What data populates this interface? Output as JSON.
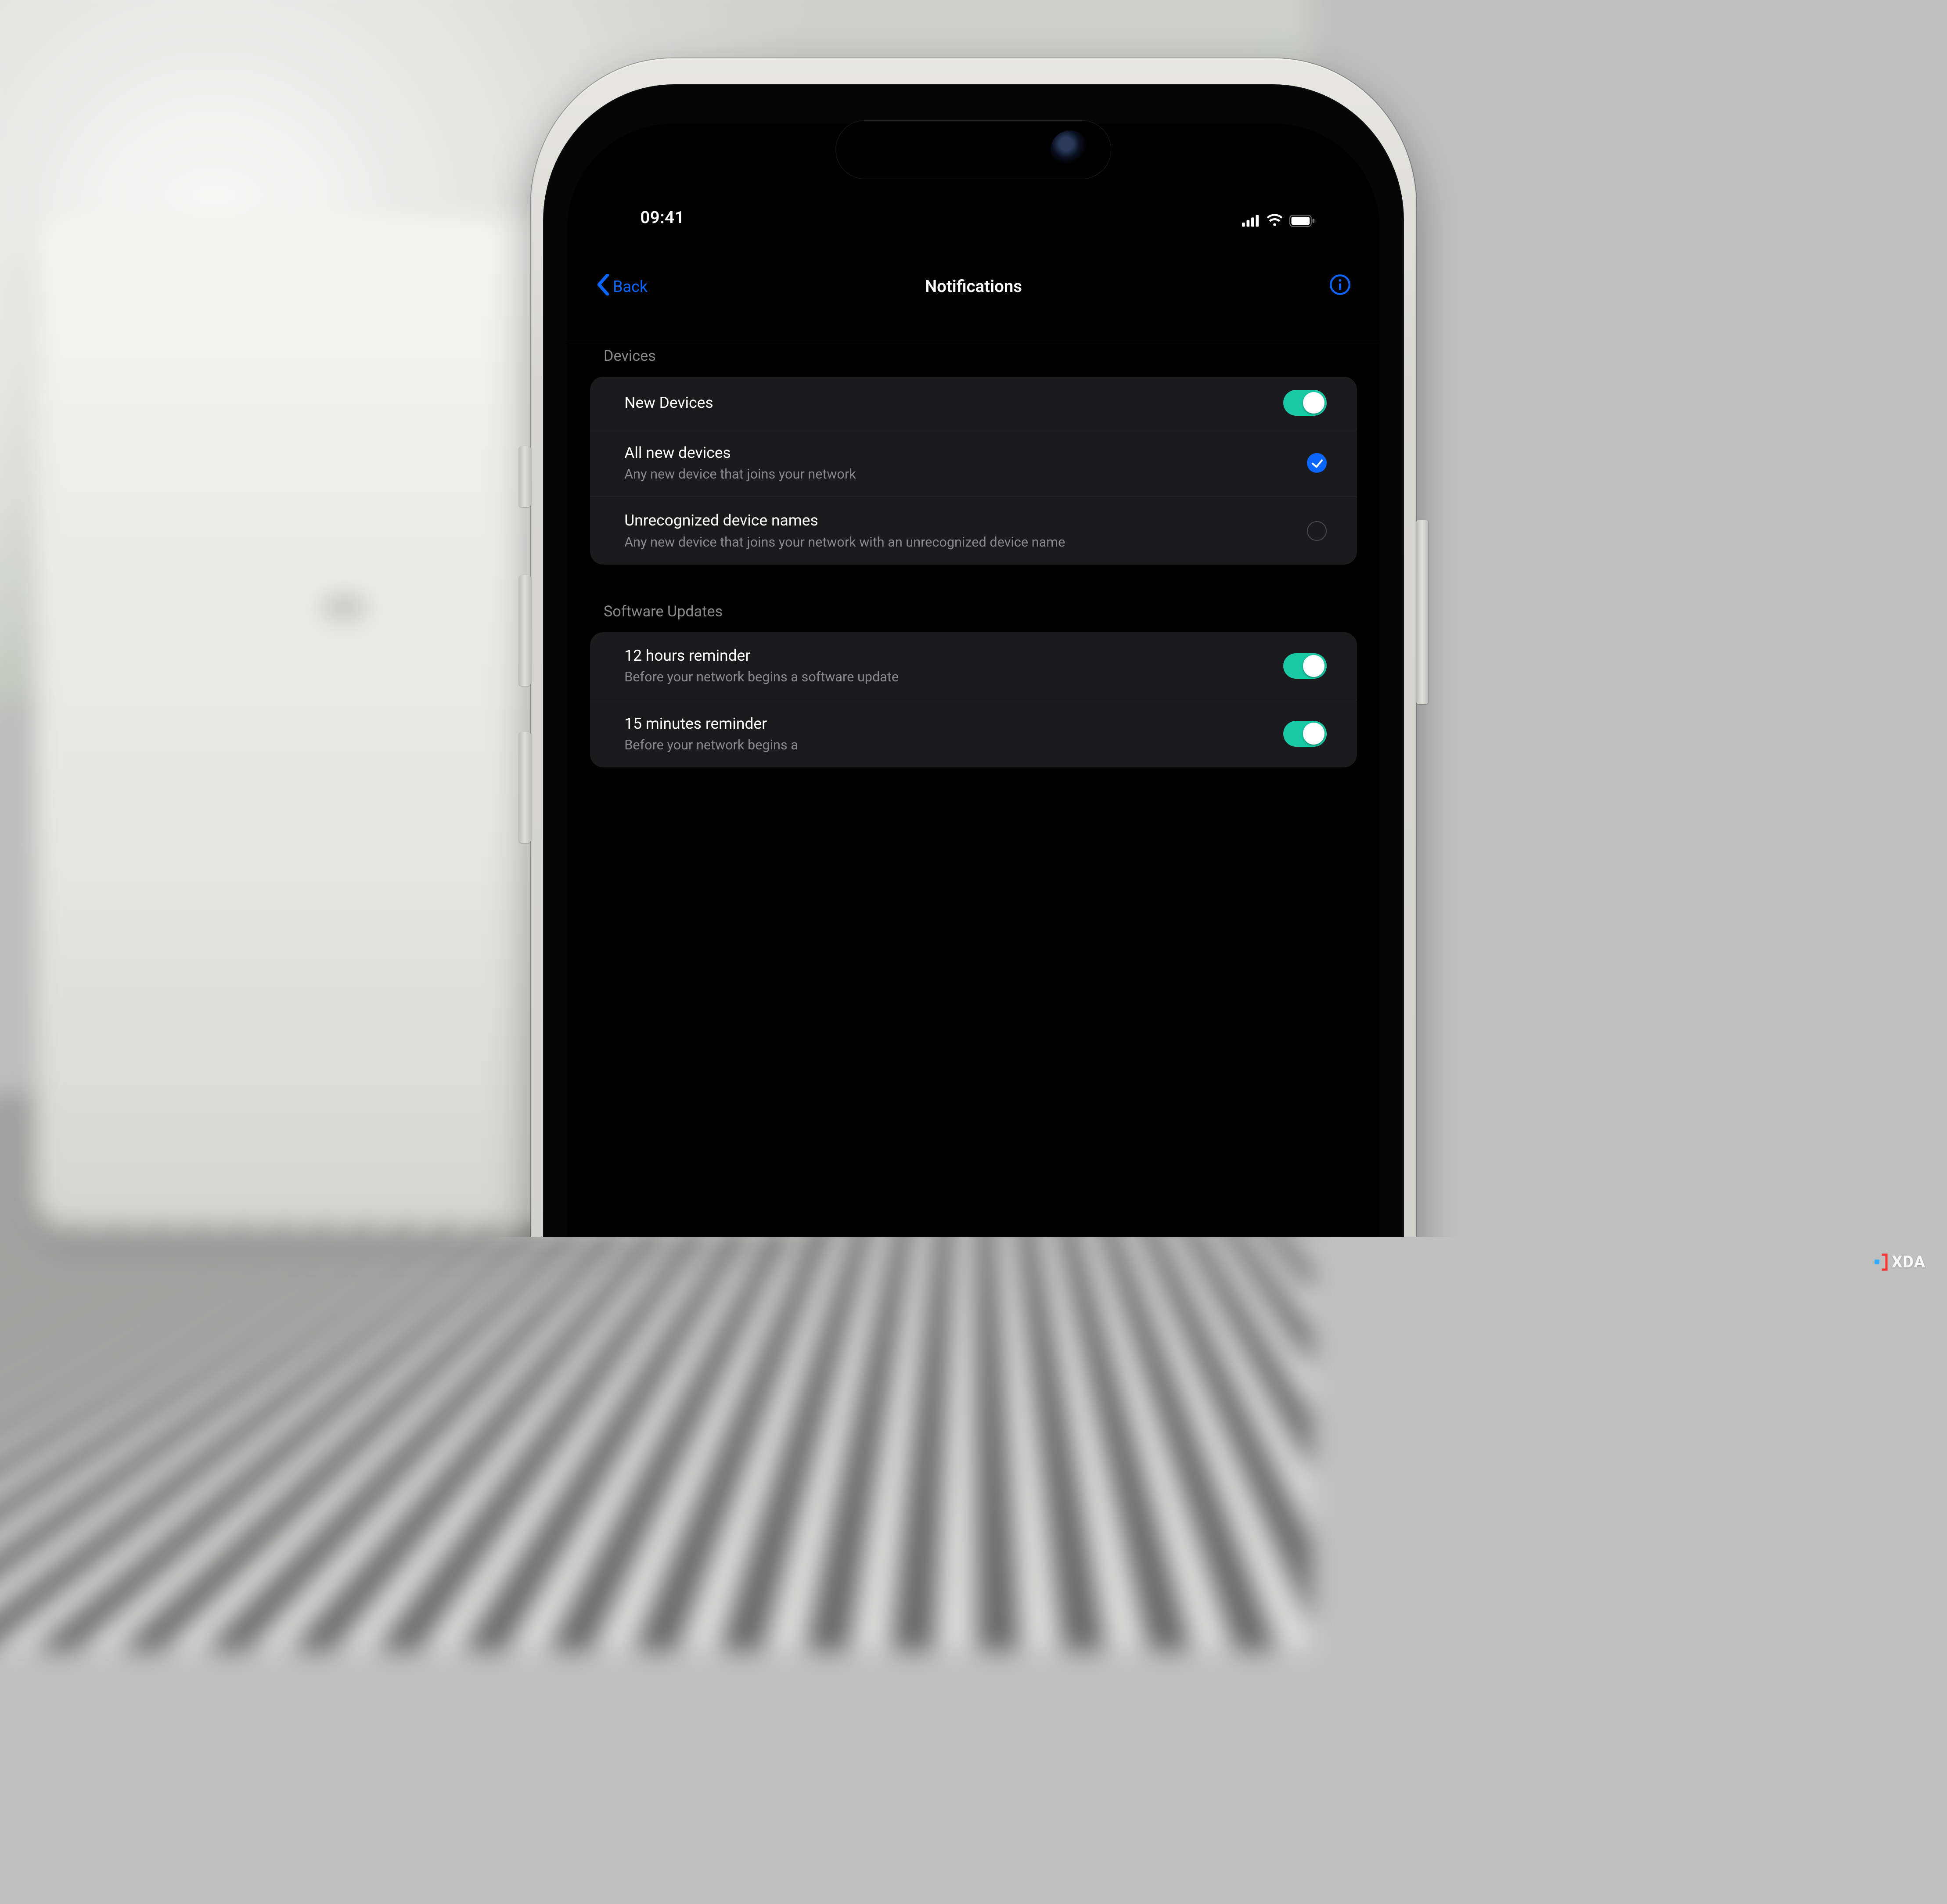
{
  "status": {
    "time": "09:41"
  },
  "nav": {
    "back": "Back",
    "title": "Notifications"
  },
  "sections": {
    "devices": {
      "header": "Devices",
      "new_devices": {
        "label": "New Devices",
        "on": true
      },
      "all_new": {
        "title": "All new devices",
        "sub": "Any new device that joins your network",
        "selected": true
      },
      "unrecognized": {
        "title": "Unrecognized device names",
        "sub": "Any new device that joins your network with an unrecognized device name",
        "selected": false
      }
    },
    "updates": {
      "header": "Software Updates",
      "r12h": {
        "title": "12 hours reminder",
        "sub": "Before your network begins a software update",
        "on": true
      },
      "r15m": {
        "title": "15 minutes reminder",
        "sub": "Before your network begins a",
        "on": true
      }
    }
  },
  "watermark": {
    "text": "XDA"
  },
  "bg": {
    "logo": "ee"
  },
  "colors": {
    "accent_blue": "#0a66ff",
    "toggle_on": "#19c9a6",
    "card_bg": "#1b1b1d",
    "muted_text": "#8a8a8e"
  }
}
